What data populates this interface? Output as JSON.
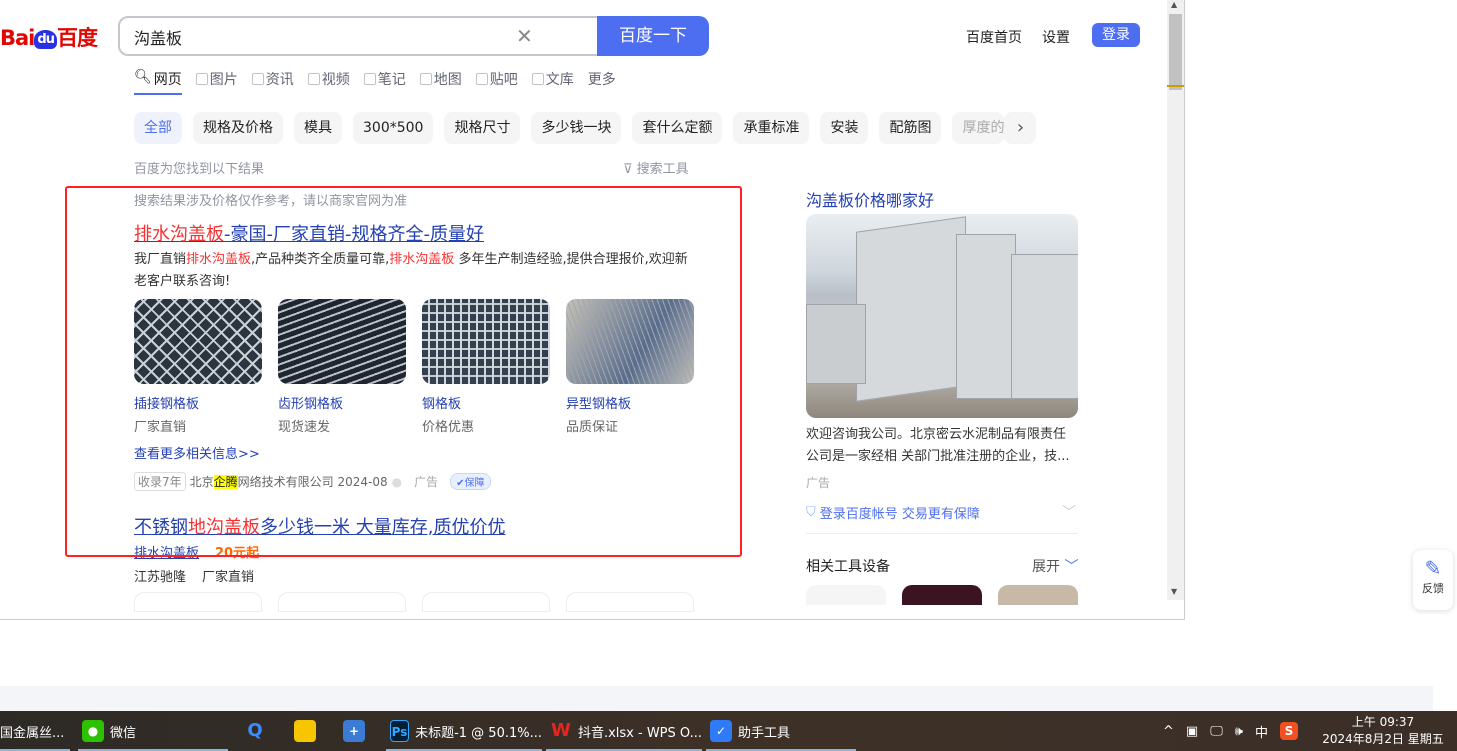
{
  "header": {
    "logo": "Bai du 百度",
    "query": "沟盖板",
    "search_button": "百度一下",
    "links": [
      "百度首页",
      "设置"
    ],
    "login": "登录"
  },
  "tabs": [
    "网页",
    "图片",
    "资讯",
    "视频",
    "笔记",
    "地图",
    "贴吧",
    "文库",
    "更多"
  ],
  "chips": [
    "全部",
    "规格及价格",
    "模具",
    "300*500",
    "规格尺寸",
    "多少钱一块",
    "套什么定额",
    "承重标准",
    "安装",
    "配筋图",
    "厚度的"
  ],
  "results_hint": "百度为您找到以下结果",
  "search_tools": "搜索工具",
  "notice": "搜索结果涉及价格仅作参考，请以商家官网为准",
  "result1": {
    "title_hl": "排水沟盖板",
    "title_rest": "-豪国-厂家直销-规格齐全-质量好",
    "desc": [
      "我厂直销",
      "排水沟盖板",
      ",产品种类齐全质量可靠,",
      "排水沟盖板",
      " 多年生产制造经验,提供合理报价,欢迎新老客户联系咨询!"
    ],
    "items": [
      {
        "name": "插接钢格板",
        "sub": "厂家直销"
      },
      {
        "name": "齿形钢格板",
        "sub": "现货速发"
      },
      {
        "name": "钢格板",
        "sub": "价格优惠"
      },
      {
        "name": "异型钢格板",
        "sub": "品质保证"
      }
    ],
    "more": "查看更多相关信息>>",
    "meta": {
      "tag": "收录7年",
      "company_pre": "北京",
      "company_hl": "企腾",
      "company_post": "网络技术有限公司 2024-08",
      "ad": "广告",
      "badge": "保障"
    }
  },
  "result2": {
    "title_a": "不锈钢",
    "title_hl": "地沟盖板",
    "title_rest": "多少钱一米 大量库存,质优价优",
    "link": "排水沟盖板",
    "price": "20元起",
    "sub1": "江苏驰隆",
    "sub2": "厂家直销"
  },
  "sidebar": {
    "title": "沟盖板价格哪家好",
    "desc": "欢迎咨询我公司。北京密云水泥制品有限责任公司是一家经相 关部门批准注册的企业，技...",
    "ad": "广告",
    "login_tip": "登录百度帐号 交易更有保障",
    "related": "相关工具设备",
    "expand": "展开"
  },
  "feedback": "反馈",
  "taskbar": {
    "items": [
      "国金属丝...",
      "微信",
      "未标题-1 @ 50.1%...",
      "抖音.xlsx - WPS O...",
      "助手工具"
    ],
    "ime": "中",
    "time": "上午 09:37",
    "date": "2024年8月2日 星期五"
  }
}
